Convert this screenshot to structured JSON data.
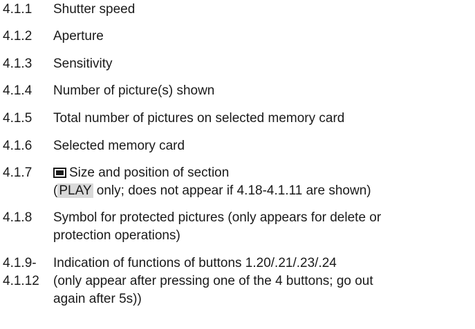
{
  "items": [
    {
      "number": "4.1.1",
      "text": "Shutter speed"
    },
    {
      "number": "4.1.2",
      "text": "Aperture"
    },
    {
      "number": "4.1.3",
      "text": "Sensitivity"
    },
    {
      "number": "4.1.4",
      "text": "Number of picture(s) shown"
    },
    {
      "number": "4.1.5",
      "text": "Total number of pictures on selected memory card"
    },
    {
      "number": "4.1.6",
      "text": "Selected memory card"
    },
    {
      "number": "4.1.7",
      "icon": "section-frame-icon",
      "text": "Size and position of section",
      "line2_open": "(",
      "line2_badge": "PLAY",
      "line2_rest": " only; does not appear if 4.18-4.1.11 are shown)"
    },
    {
      "number": "4.1.8",
      "text": "Symbol for protected pictures (only appears for delete or",
      "line2": "protection operations)"
    },
    {
      "number": "4.1.9-",
      "number2": "4.1.12",
      "text": "Indication of functions of buttons 1.20/.21/.23/.24",
      "line2": "(only appear after pressing one of the 4 buttons; go out",
      "line3": "again after 5s))"
    }
  ]
}
